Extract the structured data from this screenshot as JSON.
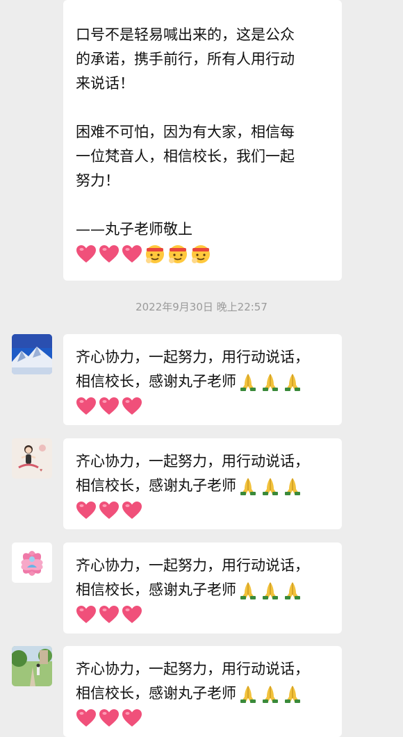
{
  "first_message": {
    "lines": [
      "口号不是轻易喊出来的，这是公众",
      "的承诺，携手前行，所有人用行动",
      "来说话！",
      "",
      "困难不可怕，因为有大家，相信每",
      "一位梵音人，相信校长，我们一起",
      "努力！",
      "",
      "——丸子老师敬上"
    ],
    "emojis": [
      "heart-icon",
      "heart-icon",
      "heart-icon",
      "cheering-face-icon",
      "cheering-face-icon",
      "cheering-face-icon"
    ]
  },
  "timestamp": "2022年9月30日 晚上22:57",
  "replies": [
    {
      "avatar": "snowy-mountain-avatar",
      "line1": "齐心协力，一起努力，用行动说话，",
      "line2": "相信校长，感谢丸子老师",
      "emojis": [
        "folded-hands-icon",
        "folded-hands-icon",
        "folded-hands-icon",
        "heart-icon",
        "heart-icon",
        "heart-icon"
      ]
    },
    {
      "avatar": "yoga-girl-avatar",
      "line1": "齐心协力，一起努力，用行动说话，",
      "line2": "相信校长，感谢丸子老师",
      "emojis": [
        "folded-hands-icon",
        "folded-hands-icon",
        "folded-hands-icon",
        "heart-icon",
        "heart-icon",
        "heart-icon"
      ]
    },
    {
      "avatar": "lotus-meditation-avatar",
      "line1": "齐心协力，一起努力，用行动说话，",
      "line2": "相信校长，感谢丸子老师",
      "emojis": [
        "folded-hands-icon",
        "folded-hands-icon",
        "folded-hands-icon",
        "heart-icon",
        "heart-icon",
        "heart-icon"
      ]
    },
    {
      "avatar": "park-walk-avatar",
      "line1": "齐心协力，一起努力，用行动说话，",
      "line2": "相信校长，感谢丸子老师",
      "emojis": [
        "folded-hands-icon",
        "folded-hands-icon",
        "folded-hands-icon",
        "heart-icon",
        "heart-icon",
        "heart-icon"
      ]
    }
  ],
  "colors": {
    "background": "#ededed",
    "bubble": "#ffffff",
    "timestamp": "#9a9a9a",
    "heart": "#f0507a"
  }
}
